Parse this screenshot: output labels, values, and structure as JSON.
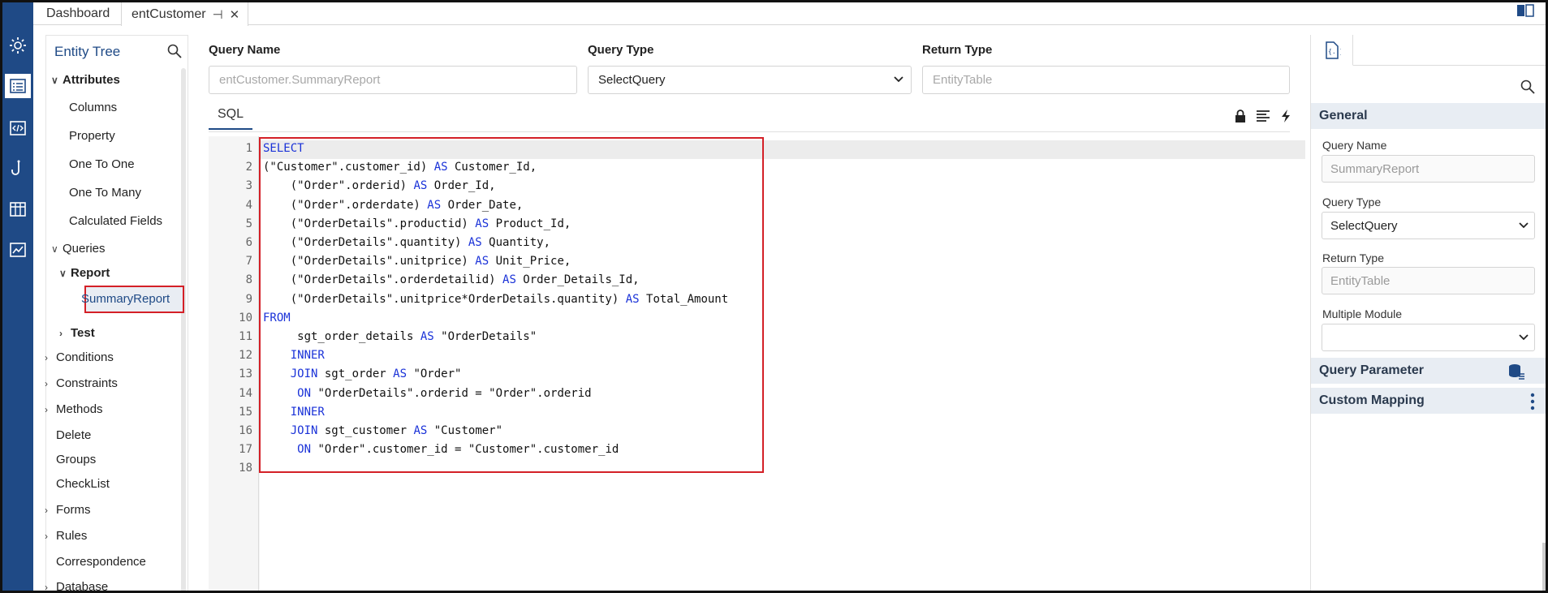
{
  "tabs": [
    {
      "label": "Dashboard"
    },
    {
      "label": "entCustomer"
    }
  ],
  "tree": {
    "title": "Entity Tree",
    "items": [
      {
        "label": "Attributes"
      },
      {
        "label": "Columns"
      },
      {
        "label": "Property"
      },
      {
        "label": "One To One"
      },
      {
        "label": "One To Many"
      },
      {
        "label": "Calculated Fields"
      },
      {
        "label": "Queries"
      },
      {
        "label": "Report"
      },
      {
        "label": "SummaryReport"
      },
      {
        "label": "Test"
      },
      {
        "label": "Conditions"
      },
      {
        "label": "Constraints"
      },
      {
        "label": "Methods"
      },
      {
        "label": "Delete"
      },
      {
        "label": "Groups"
      },
      {
        "label": "CheckList"
      },
      {
        "label": "Forms"
      },
      {
        "label": "Rules"
      },
      {
        "label": "Correspondence"
      },
      {
        "label": "Database"
      }
    ]
  },
  "query": {
    "name_label": "Query Name",
    "name_placeholder": "entCustomer.SummaryReport",
    "type_label": "Query Type",
    "type_value": "SelectQuery",
    "return_label": "Return Type",
    "return_placeholder": "EntityTable",
    "sql_tab": "SQL"
  },
  "editor": {
    "line_numbers": [
      "1",
      "2",
      "3",
      "4",
      "5",
      "6",
      "7",
      "8",
      "9",
      "10",
      "11",
      "12",
      "13",
      "14",
      "15",
      "16",
      "17",
      "18"
    ],
    "lines": [
      [
        {
          "t": "SELECT",
          "k": true
        }
      ],
      [
        {
          "t": "(\"Customer\".customer_id) "
        },
        {
          "t": "AS",
          "k": true
        },
        {
          "t": " Customer_Id,"
        }
      ],
      [
        {
          "t": "    (\"Order\".orderid) "
        },
        {
          "t": "AS",
          "k": true
        },
        {
          "t": " Order_Id,"
        }
      ],
      [
        {
          "t": "    (\"Order\".orderdate) "
        },
        {
          "t": "AS",
          "k": true
        },
        {
          "t": " Order_Date,"
        }
      ],
      [
        {
          "t": "    (\"OrderDetails\".productid) "
        },
        {
          "t": "AS",
          "k": true
        },
        {
          "t": " Product_Id,"
        }
      ],
      [
        {
          "t": "    (\"OrderDetails\".quantity) "
        },
        {
          "t": "AS",
          "k": true
        },
        {
          "t": " Quantity,"
        }
      ],
      [
        {
          "t": "    (\"OrderDetails\".unitprice) "
        },
        {
          "t": "AS",
          "k": true
        },
        {
          "t": " Unit_Price,"
        }
      ],
      [
        {
          "t": "    (\"OrderDetails\".orderdetailid) "
        },
        {
          "t": "AS",
          "k": true
        },
        {
          "t": " Order_Details_Id,"
        }
      ],
      [
        {
          "t": "    (\"OrderDetails\".unitprice*OrderDetails.quantity) "
        },
        {
          "t": "AS",
          "k": true
        },
        {
          "t": " Total_Amount"
        }
      ],
      [
        {
          "t": "FROM",
          "k": true
        }
      ],
      [
        {
          "t": "     sgt_order_details "
        },
        {
          "t": "AS",
          "k": true
        },
        {
          "t": " \"OrderDetails\""
        }
      ],
      [
        {
          "t": "    "
        },
        {
          "t": "INNER",
          "k": true
        }
      ],
      [
        {
          "t": "    "
        },
        {
          "t": "JOIN",
          "k": true
        },
        {
          "t": " sgt_order "
        },
        {
          "t": "AS",
          "k": true
        },
        {
          "t": " \"Order\""
        }
      ],
      [
        {
          "t": "     "
        },
        {
          "t": "ON",
          "k": true
        },
        {
          "t": " \"OrderDetails\".orderid = \"Order\".orderid"
        }
      ],
      [
        {
          "t": "    "
        },
        {
          "t": "INNER",
          "k": true
        }
      ],
      [
        {
          "t": "    "
        },
        {
          "t": "JOIN",
          "k": true
        },
        {
          "t": " sgt_customer "
        },
        {
          "t": "AS",
          "k": true
        },
        {
          "t": " \"Customer\""
        }
      ],
      [
        {
          "t": "     "
        },
        {
          "t": "ON",
          "k": true
        },
        {
          "t": " \"Order\".customer_id = \"Customer\".customer_id"
        }
      ],
      []
    ]
  },
  "props": {
    "general": "General",
    "name_label": "Query Name",
    "name_placeholder": "SummaryReport",
    "type_label": "Query Type",
    "type_value": "SelectQuery",
    "return_label": "Return Type",
    "return_placeholder": "EntityTable",
    "module_label": "Multiple Module",
    "module_value": "",
    "query_parameter": "Query Parameter",
    "custom_mapping": "Custom Mapping"
  },
  "colors": {
    "rail": "#1f4a86",
    "keyword": "#1a32d8",
    "highlight_box": "#d42027"
  },
  "icons": [
    "settings-icon",
    "list-icon",
    "code-icon",
    "hook-icon",
    "table-icon",
    "chart-icon",
    "search-icon",
    "pin-icon",
    "close-icon",
    "lock-icon",
    "align-icon",
    "lightning-icon",
    "braces-doc-icon",
    "database-icon",
    "more-vertical-icon",
    "chevron-down-icon"
  ]
}
